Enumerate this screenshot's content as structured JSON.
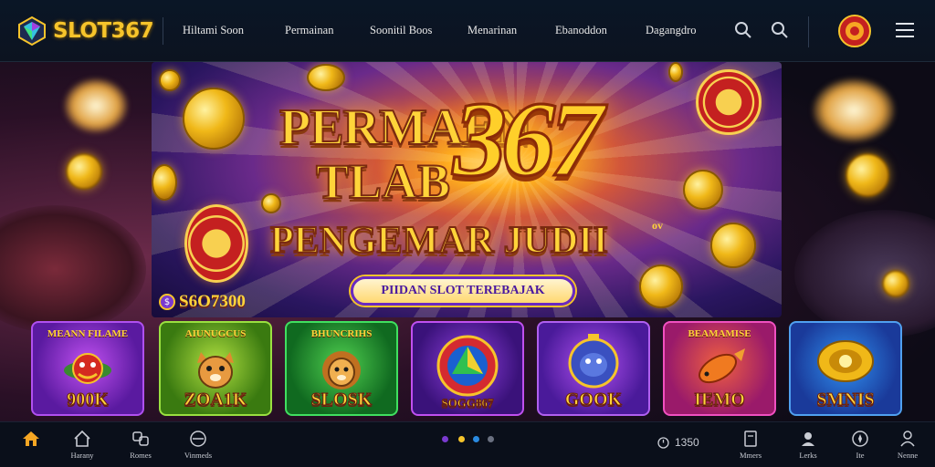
{
  "brand": {
    "name": "SLOT367"
  },
  "nav": {
    "items": [
      {
        "label": "Hiltami Soon"
      },
      {
        "label": "Permainan"
      },
      {
        "label": "Soonitil Boos"
      },
      {
        "label": "Menarinan"
      },
      {
        "label": "Ebanoddon"
      },
      {
        "label": "Dagangdro"
      }
    ]
  },
  "hero": {
    "line1": "PERMAEN",
    "line2": "TLAB",
    "big_number": "367",
    "line3": "PENGEMAR JUDII",
    "line3_sup": "ov",
    "cta_label": "PIIDAN SLOT TEREBAJAK",
    "jackpot_badge": "$",
    "jackpot_value": "S6O7300"
  },
  "games": [
    {
      "title": "MEANN FILAME",
      "value": "900K",
      "icon": "dragon-icon",
      "accent": "#8a2ad0"
    },
    {
      "title": "AIUNUGCUS",
      "value": "ZOA1K",
      "icon": "tiger-icon",
      "accent": "#6ac020"
    },
    {
      "title": "BHUNCRIHS",
      "value": "SLOSK",
      "icon": "lion-icon",
      "accent": "#30c040"
    },
    {
      "title": "",
      "value": "SOGG867",
      "icon": "wheel-icon",
      "accent": "#a030c0"
    },
    {
      "title": "",
      "value": "GOOK",
      "icon": "panther-icon",
      "accent": "#9030d0"
    },
    {
      "title": "BEAMAMISE",
      "value": "IEMO",
      "icon": "fish-icon",
      "accent": "#c030a0"
    },
    {
      "title": "",
      "value": "SMNIS",
      "icon": "gold-crest-icon",
      "accent": "#3080e0"
    }
  ],
  "bottom_nav": {
    "left": [
      {
        "label": "",
        "icon": "home-icon"
      },
      {
        "label": "Harany",
        "icon": "house-outline-icon"
      },
      {
        "label": "Romes",
        "icon": "dice-icon"
      },
      {
        "label": "Vinmeds",
        "icon": "tray-icon"
      }
    ],
    "clock": "1350",
    "right": [
      {
        "label": "Mmers",
        "icon": "doc-icon"
      },
      {
        "label": "Lerks",
        "icon": "user-badge-icon"
      },
      {
        "label": "Ite",
        "icon": "compass-icon"
      },
      {
        "label": "Nenne",
        "icon": "person-icon"
      }
    ]
  },
  "pager": {
    "active_index": 1,
    "count": 4
  },
  "colors": {
    "gold": "#f6c42b",
    "bar": "#0a1626",
    "active_nav": "#f6a623"
  }
}
